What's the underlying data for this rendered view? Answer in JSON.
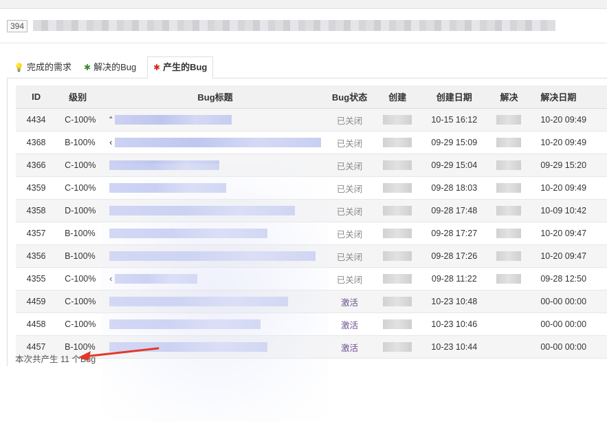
{
  "header": {
    "id_badge": "394"
  },
  "tabs": [
    {
      "label": "完成的需求",
      "icon": "lightbulb-icon",
      "color": "#5a8a2a"
    },
    {
      "label": "解决的Bug",
      "icon": "bug-icon",
      "color": "#3c8b2e"
    },
    {
      "label": "产生的Bug",
      "icon": "bug-icon",
      "color": "#d0281d",
      "active": true
    }
  ],
  "table": {
    "columns": [
      "ID",
      "级别",
      "Bug标题",
      "Bug状态",
      "创建",
      "创建日期",
      "解决",
      "解决日期"
    ],
    "rows": [
      {
        "id": "4434",
        "level": "C-100%",
        "title_prefix": "“",
        "status": "已关闭",
        "created": "10-15 16:12",
        "resolved": "10-20 09:49"
      },
      {
        "id": "4368",
        "level": "B-100%",
        "title_prefix": "‹",
        "status": "已关闭",
        "created": "09-29 15:09",
        "resolved": "10-20 09:49"
      },
      {
        "id": "4366",
        "level": "C-100%",
        "title_prefix": "",
        "status": "已关闭",
        "created": "09-29 15:04",
        "resolved": "09-29 15:20"
      },
      {
        "id": "4359",
        "level": "C-100%",
        "title_prefix": "",
        "status": "已关闭",
        "created": "09-28 18:03",
        "resolved": "10-20 09:49"
      },
      {
        "id": "4358",
        "level": "D-100%",
        "title_prefix": "",
        "status": "已关闭",
        "created": "09-28 17:48",
        "resolved": "10-09 10:42"
      },
      {
        "id": "4357",
        "level": "B-100%",
        "title_prefix": "",
        "status": "已关闭",
        "created": "09-28 17:27",
        "resolved": "10-20 09:47"
      },
      {
        "id": "4356",
        "level": "B-100%",
        "title_prefix": "",
        "status": "已关闭",
        "created": "09-28 17:26",
        "resolved": "10-20 09:47"
      },
      {
        "id": "4355",
        "level": "C-100%",
        "title_prefix": "‹",
        "status": "已关闭",
        "created": "09-28 11:22",
        "resolved": "09-28 12:50"
      },
      {
        "id": "4459",
        "level": "C-100%",
        "title_prefix": "",
        "status": "激活",
        "created": "10-23 10:48",
        "resolved": "00-00 00:00"
      },
      {
        "id": "4458",
        "level": "C-100%",
        "title_prefix": "",
        "status": "激活",
        "created": "10-23 10:46",
        "resolved": "00-00 00:00"
      },
      {
        "id": "4457",
        "level": "B-100%",
        "title_prefix": "",
        "status": "激活",
        "created": "10-23 10:44",
        "resolved": "00-00 00:00"
      }
    ]
  },
  "footer": {
    "summary": "本次共产生 11 个Bug"
  },
  "colors": {
    "arrow": "#e03a2c",
    "active_status": "#6a4f8f",
    "closed_status": "#888888"
  }
}
